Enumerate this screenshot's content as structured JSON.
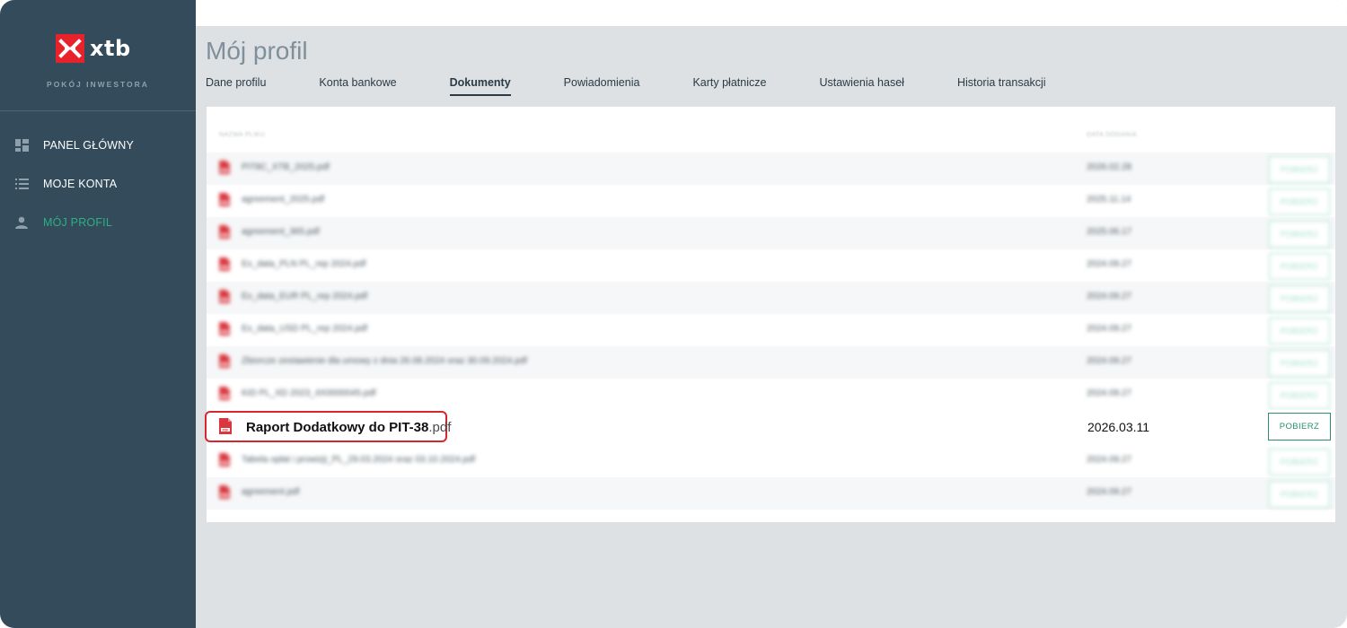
{
  "brand": {
    "name": "xtb",
    "subtitle": "POKÓJ INWESTORA",
    "logo_color": "#e8222b"
  },
  "sidebar": {
    "items": [
      {
        "label": "PANEL GŁÓWNY",
        "icon": "dashboard-icon",
        "active": false
      },
      {
        "label": "MOJE KONTA",
        "icon": "list-icon",
        "active": false
      },
      {
        "label": "MÓJ PROFIL",
        "icon": "user-icon",
        "active": true
      }
    ]
  },
  "page": {
    "title": "Mój profil",
    "tabs": [
      {
        "label": "Dane profilu",
        "active": false
      },
      {
        "label": "Konta bankowe",
        "active": false
      },
      {
        "label": "Dokumenty",
        "active": true
      },
      {
        "label": "Powiadomienia",
        "active": false
      },
      {
        "label": "Karty płatnicze",
        "active": false
      },
      {
        "label": "Ustawienia haseł",
        "active": false
      },
      {
        "label": "Historia transakcji",
        "active": false
      }
    ]
  },
  "documents": {
    "columns": {
      "name": "NAZWA PLIKU",
      "date": "DATA DODANIA"
    },
    "download_label": "POBIERZ",
    "accent_color": "#2db083",
    "highlight_color": "#d9252e",
    "blurred_rows_before": [
      {
        "name": "PIT8C_XTB_2025.pdf",
        "date": "2026.02.28"
      },
      {
        "name": "agreement_2025.pdf",
        "date": "2025.11.14"
      },
      {
        "name": "agreement_365.pdf",
        "date": "2025.06.17"
      },
      {
        "name": "Ex_data_PLN PL_rep 2024.pdf",
        "date": "2024.09.27"
      },
      {
        "name": "Ex_data_EUR PL_rep 2024.pdf",
        "date": "2024.09.27"
      },
      {
        "name": "Ex_data_USD PL_rep 2024.pdf",
        "date": "2024.09.27"
      },
      {
        "name": "Zbiorcze zestawienie dla umowy z dnia 26.08.2024 oraz 30.09.2024.pdf",
        "date": "2024.09.27"
      },
      {
        "name": "KID PL_XD 2023_4X0000045.pdf",
        "date": "2024.09.27"
      }
    ],
    "highlighted": {
      "name_main": "Raport Dodatkowy do PIT-38",
      "name_ext": ".pdf",
      "date": "2026.03.11"
    },
    "blurred_rows_after": [
      {
        "name": "Tabela opłat i prowizji_PL_29.03.2024 oraz 03.10.2024.pdf",
        "date": "2024.09.27"
      },
      {
        "name": "agreement.pdf",
        "date": "2024.09.27"
      }
    ]
  }
}
